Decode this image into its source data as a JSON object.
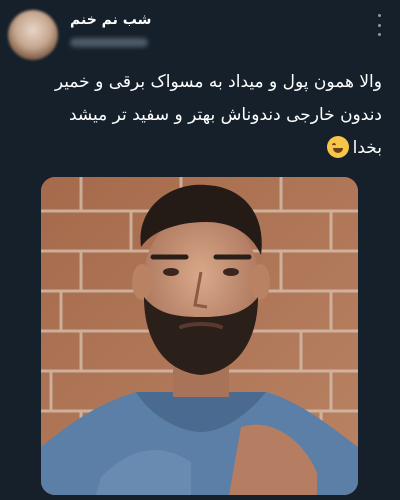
{
  "tweet": {
    "display_name": "شب نم خنم",
    "text_lines": [
      "والا همون پول و میداد به مسواک برقی و خمیر",
      "دندون خارجی  دندوناش بهتر و سفید تر میشد",
      "بخدا"
    ],
    "emoji": "rolling-on-floor-laughing-emoji"
  },
  "icons": {
    "more": "more-vertical-icon"
  },
  "colors": {
    "background": "#15202b",
    "text": "#ffffff",
    "secondary": "#8b98a5"
  }
}
